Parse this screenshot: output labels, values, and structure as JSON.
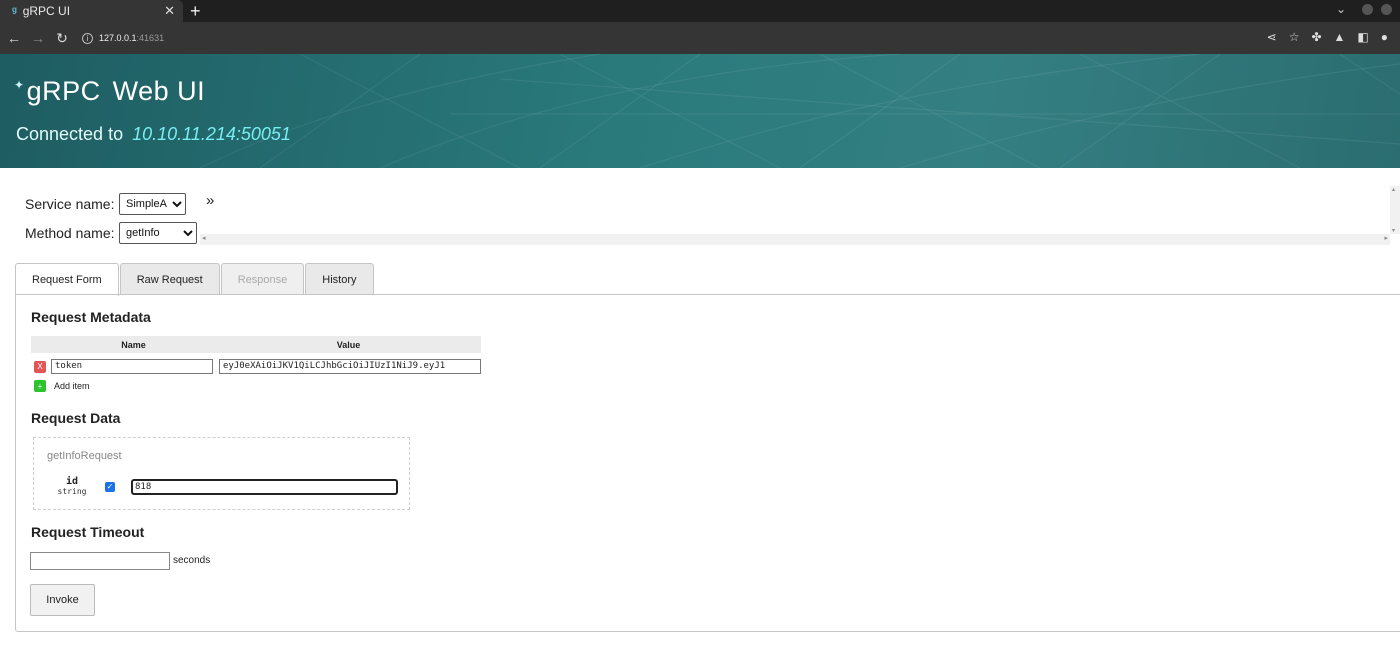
{
  "browser": {
    "tab_title": "gRPC UI",
    "tab_favicon": "grpc-logo-icon",
    "address_host": "127.0.0.1",
    "address_port": ":41631"
  },
  "header": {
    "brand_grpc": "gRPC",
    "brand_webui": "Web UI",
    "connected_label": "Connected to",
    "connected_address": "10.10.11.214:50051"
  },
  "service": {
    "service_label": "Service name:",
    "service_value": "SimpleApp",
    "method_label": "Method name:",
    "method_value": "getInfo",
    "expand_glyph": "»"
  },
  "tabs": [
    {
      "label": "Request Form",
      "state": "active"
    },
    {
      "label": "Raw Request",
      "state": "normal"
    },
    {
      "label": "Response",
      "state": "disabled"
    },
    {
      "label": "History",
      "state": "normal"
    }
  ],
  "metadata": {
    "heading": "Request Metadata",
    "col_name": "Name",
    "col_value": "Value",
    "rows": [
      {
        "name": "token",
        "value": "eyJ0eXAiOiJKV1QiLCJhbGciOiJIUzI1NiJ9.eyJ1"
      }
    ],
    "remove_glyph": "X",
    "add_glyph": "+",
    "add_label": "Add item"
  },
  "request_data": {
    "heading": "Request Data",
    "message_name": "getInfoRequest",
    "field_name": "id",
    "field_type": "string",
    "field_checked": true,
    "field_value": "818"
  },
  "timeout": {
    "heading": "Request Timeout",
    "value": "",
    "unit_label": "seconds"
  },
  "invoke_label": "Invoke",
  "colors": {
    "banner": "#2a7a7c",
    "address_accent": "#78eef2",
    "remove_button": "#e05555",
    "add_button": "#2ec22e",
    "checkbox": "#1a73e8"
  }
}
